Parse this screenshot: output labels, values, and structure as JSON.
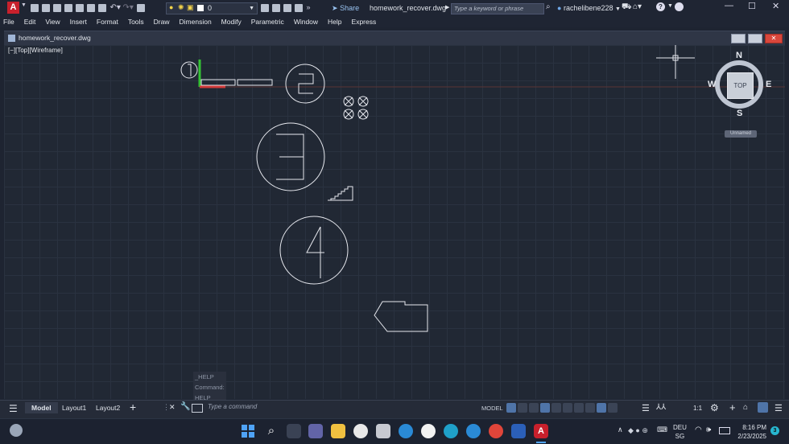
{
  "titlebar": {
    "app_letter": "A",
    "layer_value": "0",
    "share_label": "Share",
    "file_title": "homework_recover.dwg",
    "search_placeholder": "Type a keyword or phrase",
    "username": "rachelibene228"
  },
  "menu": [
    "File",
    "Edit",
    "View",
    "Insert",
    "Format",
    "Tools",
    "Draw",
    "Dimension",
    "Modify",
    "Parametric",
    "Window",
    "Help",
    "Express"
  ],
  "document": {
    "tab_title": "homework_recover.dwg",
    "view_label": "[−][Top][Wireframe]"
  },
  "viewcube": {
    "north": "N",
    "south": "S",
    "east": "E",
    "west": "W",
    "face": "TOP",
    "ucs_label": "Unnamed"
  },
  "drawing": {
    "numbers": [
      "1",
      "2",
      "3",
      "4"
    ]
  },
  "command": {
    "history": [
      "_HELP",
      "Command:",
      "HELP"
    ],
    "placeholder": "Type a command"
  },
  "layout_tabs": {
    "model": "Model",
    "layout1": "Layout1",
    "layout2": "Layout2",
    "add": "+"
  },
  "status": {
    "model_label": "MODEL",
    "scale": "1:1"
  },
  "taskbar": {
    "lang1": "DEU",
    "lang2": "SG",
    "time": "8:16 PM",
    "date": "2/23/2025",
    "notif_count": "3"
  },
  "colors": {
    "accent_red": "#c8202c",
    "ucs_green": "#34c234",
    "ucs_red": "#d23a3a",
    "drawing_line": "#e6e8ee"
  }
}
